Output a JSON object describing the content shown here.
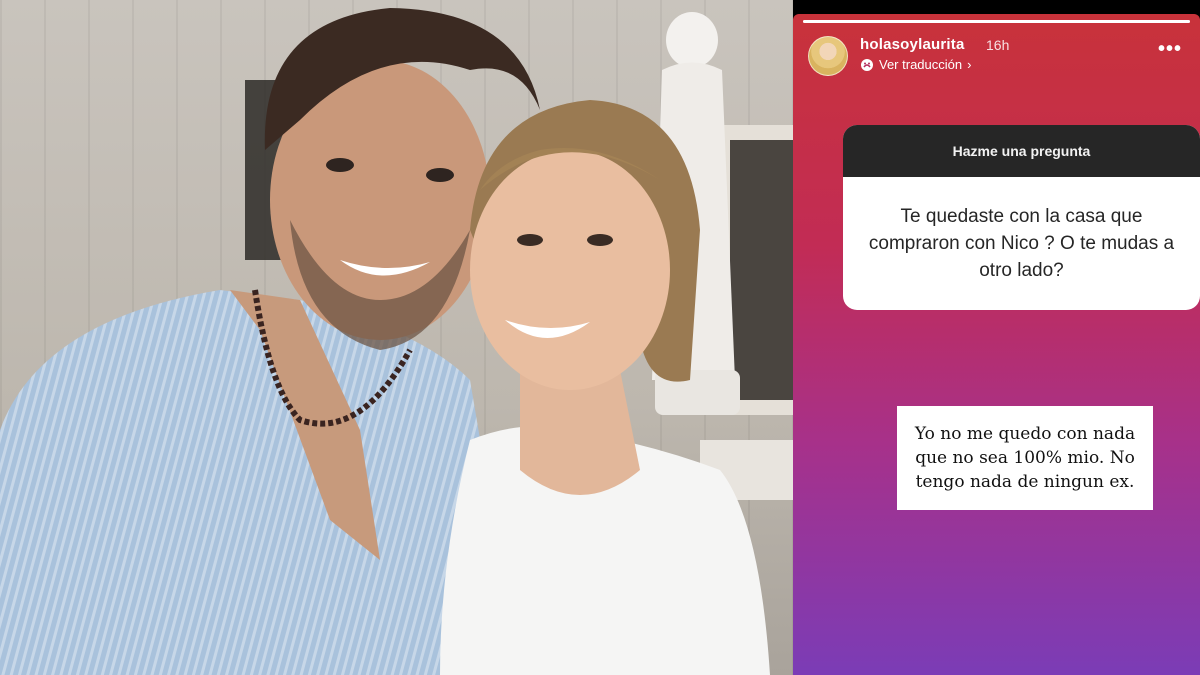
{
  "photo": {
    "description_icon": "photo-couple-icon"
  },
  "story": {
    "username": "holasoylaurita",
    "time": "16h",
    "translate_label": "Ver traducción",
    "translate_icon": "translate-icon",
    "more_label": "•••",
    "progress": 1.0,
    "question_header": "Hazme una pregunta",
    "question_text": "Te quedaste con la casa que compraron con Nico ? O te mudas a otro lado?",
    "answer_text": "Yo no me quedo con nada que no sea 100% mio. No tengo nada de ningun ex."
  },
  "colors": {
    "gradient_top": "#c8323a",
    "gradient_bottom": "#7b3cb6",
    "card_header": "#262626"
  }
}
